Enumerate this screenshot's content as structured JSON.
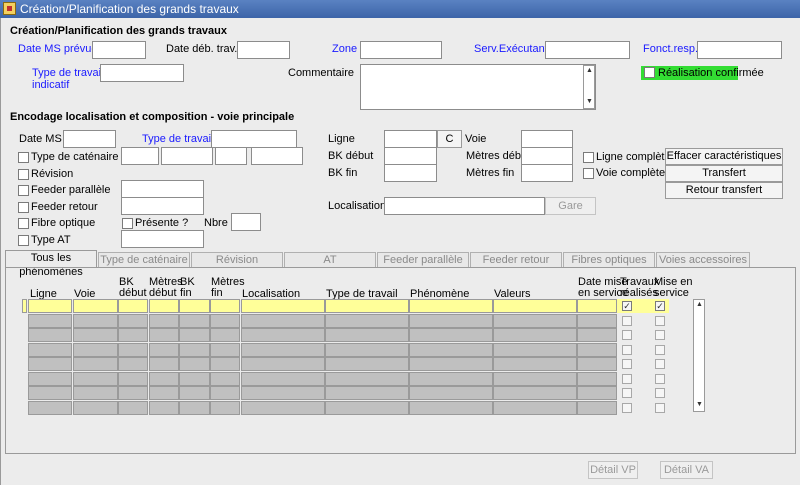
{
  "window": {
    "title": "Création/Planification des grands travaux"
  },
  "sec1": {
    "heading": "Création/Planification des grands travaux",
    "date_ms_prevue": "Date MS prévue",
    "date_deb_trav": "Date déb. trav.",
    "zone": "Zone",
    "serv_executant": "Serv.Exécutant",
    "fonct_resp": "Fonct.resp.",
    "type_travail_indicatif_1": "Type de travail",
    "type_travail_indicatif_2": "indicatif",
    "commentaire": "Commentaire",
    "realisation_confirmee": "Réalisation confirmée"
  },
  "sec2": {
    "heading": "Encodage localisation et composition - voie principale",
    "date_ms": "Date MS",
    "type_travail": "Type de travail",
    "type_catenaire": "Type de caténaire",
    "revision": "Révision",
    "feeder_parallele": "Feeder parallèle",
    "feeder_retour": "Feeder retour",
    "fibre_optique": "Fibre optique",
    "presente": "Présente ?",
    "nbre": "Nbre",
    "type_at": "Type AT",
    "ligne": "Ligne",
    "c_button": "C",
    "voie": "Voie",
    "bk_debut": "BK début",
    "metres_deb": "Mètres déb",
    "bk_fin": "BK fin",
    "metres_fin": "Mètres fin",
    "ligne_complete": "Ligne complète ?",
    "voie_complete": "Voie complète ?",
    "localisation": "Localisation",
    "gare_button": "Gare",
    "effacer_button": "Effacer caractéristiques",
    "transfert_button": "Transfert",
    "retour_transfert_button": "Retour transfert"
  },
  "tabs": [
    {
      "label": "Tous les phénomènes"
    },
    {
      "label": "Type de caténaire"
    },
    {
      "label": "Révision"
    },
    {
      "label": "AT"
    },
    {
      "label": "Feeder parallèle"
    },
    {
      "label": "Feeder retour"
    },
    {
      "label": "Fibres optiques"
    },
    {
      "label": "Voies accessoires"
    }
  ],
  "grid": {
    "headers": {
      "ligne": "Ligne",
      "voie": "Voie",
      "bk_debut_1": "BK",
      "bk_debut_2": "début",
      "metres_debut_1": "Mètres",
      "metres_debut_2": "début",
      "bk_fin_1": "BK",
      "bk_fin_2": "fin",
      "metres_fin_1": "Mètres",
      "metres_fin_2": "fin",
      "localisation": "Localisation",
      "type_travail": "Type de travail",
      "phenomene": "Phénomène",
      "valeurs": "Valeurs",
      "date_mise_1": "Date mise",
      "date_mise_2": "en service",
      "travaux_1": "Travaux",
      "travaux_2": "réalisés",
      "mise_1": "Mise en",
      "mise_2": "service"
    },
    "rows": 8
  },
  "footer": {
    "detail_vp": "Détail VP",
    "detail_va": "Détail VA"
  }
}
